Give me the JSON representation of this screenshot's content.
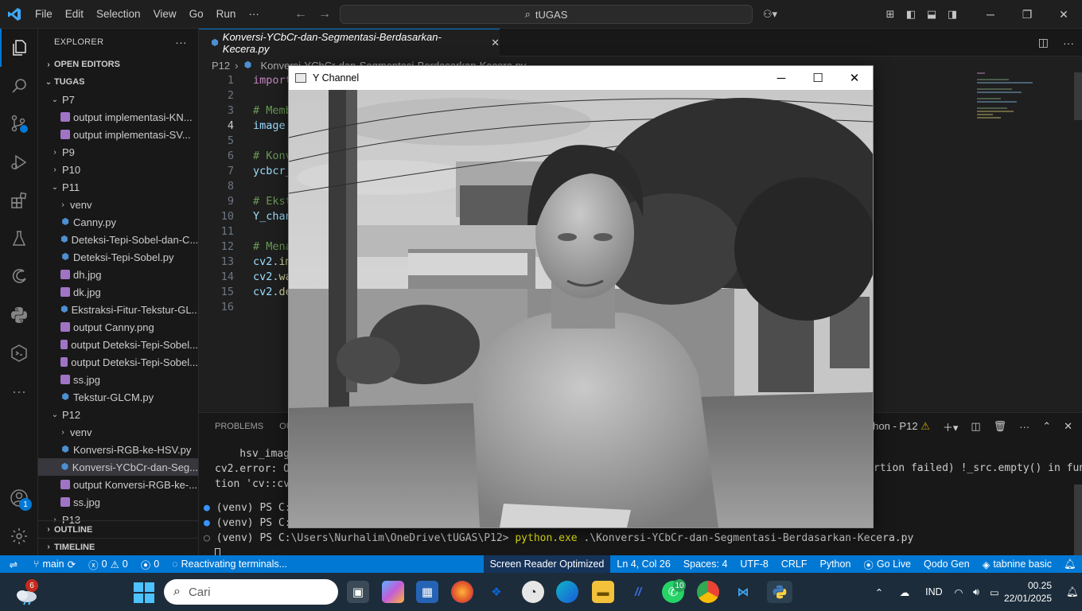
{
  "titlebar": {
    "menus": [
      "File",
      "Edit",
      "Selection",
      "View",
      "Go",
      "Run",
      "···"
    ],
    "search": "tUGAS"
  },
  "activity": {
    "accounts_badge": "1"
  },
  "explorer": {
    "title": "EXPLORER",
    "open_editors": "OPEN EDITORS",
    "root": "TUGAS",
    "tree": [
      {
        "label": "P7",
        "type": "folder-open",
        "indent": 1
      },
      {
        "label": "output implementasi-KN...",
        "type": "img",
        "indent": 2
      },
      {
        "label": "output implementasi-SV...",
        "type": "img",
        "indent": 2
      },
      {
        "label": "P9",
        "type": "folder",
        "indent": 1
      },
      {
        "label": "P10",
        "type": "folder",
        "indent": 1
      },
      {
        "label": "P11",
        "type": "folder-open",
        "indent": 1
      },
      {
        "label": "venv",
        "type": "folder",
        "indent": 2
      },
      {
        "label": "Canny.py",
        "type": "py",
        "indent": 2
      },
      {
        "label": "Deteksi-Tepi-Sobel-dan-C...",
        "type": "py",
        "indent": 2
      },
      {
        "label": "Deteksi-Tepi-Sobel.py",
        "type": "py",
        "indent": 2
      },
      {
        "label": "dh.jpg",
        "type": "img",
        "indent": 2
      },
      {
        "label": "dk.jpg",
        "type": "img",
        "indent": 2
      },
      {
        "label": "Ekstraksi-Fitur-Tekstur-GL...",
        "type": "py",
        "indent": 2
      },
      {
        "label": "output Canny.png",
        "type": "img",
        "indent": 2
      },
      {
        "label": "output Deteksi-Tepi-Sobel...",
        "type": "img",
        "indent": 2
      },
      {
        "label": "output Deteksi-Tepi-Sobel...",
        "type": "img",
        "indent": 2
      },
      {
        "label": "ss.jpg",
        "type": "img",
        "indent": 2
      },
      {
        "label": "Tekstur-GLCM.py",
        "type": "py",
        "indent": 2
      },
      {
        "label": "P12",
        "type": "folder-open",
        "indent": 1
      },
      {
        "label": "venv",
        "type": "folder",
        "indent": 2
      },
      {
        "label": "Konversi-RGB-ke-HSV.py",
        "type": "py",
        "indent": 2
      },
      {
        "label": "Konversi-YCbCr-dan-Seg...",
        "type": "py",
        "indent": 2,
        "selected": true
      },
      {
        "label": "output Konversi-RGB-ke-...",
        "type": "img",
        "indent": 2
      },
      {
        "label": "ss.jpg",
        "type": "img",
        "indent": 2
      },
      {
        "label": "P13",
        "type": "folder",
        "indent": 1
      }
    ],
    "outline": "OUTLINE",
    "timeline": "TIMELINE"
  },
  "editor": {
    "tab_label": "Konversi-YCbCr-dan-Segmentasi-Berdasarkan-Kecera.py",
    "breadcrumb_folder": "P12",
    "breadcrumb_file": "Konversi-YCbCr-dan-Segmentasi-Berdasarkan-Kecera.py",
    "lines": [
      {
        "n": "1",
        "parts": [
          [
            "kw",
            "import"
          ]
        ]
      },
      {
        "n": "2",
        "parts": []
      },
      {
        "n": "3",
        "parts": [
          [
            "cm",
            "# Memb"
          ]
        ]
      },
      {
        "n": "4",
        "parts": [
          [
            "vr",
            "image"
          ]
        ],
        "current": true
      },
      {
        "n": "5",
        "parts": []
      },
      {
        "n": "6",
        "parts": [
          [
            "cm",
            "# Konv"
          ]
        ]
      },
      {
        "n": "7",
        "parts": [
          [
            "vr",
            "ycbcr_"
          ]
        ]
      },
      {
        "n": "8",
        "parts": []
      },
      {
        "n": "9",
        "parts": [
          [
            "cm",
            "# Ekst"
          ]
        ]
      },
      {
        "n": "10",
        "parts": [
          [
            "vr",
            "Y_chan"
          ]
        ]
      },
      {
        "n": "11",
        "parts": []
      },
      {
        "n": "12",
        "parts": [
          [
            "cm",
            "# Mena"
          ]
        ]
      },
      {
        "n": "13",
        "parts": [
          [
            "vr",
            "cv2."
          ],
          [
            "fn",
            "im"
          ]
        ]
      },
      {
        "n": "14",
        "parts": [
          [
            "vr",
            "cv2."
          ],
          [
            "fn",
            "wa"
          ]
        ]
      },
      {
        "n": "15",
        "parts": [
          [
            "vr",
            "cv2."
          ],
          [
            "fn",
            "de"
          ]
        ]
      },
      {
        "n": "16",
        "parts": []
      }
    ]
  },
  "panel": {
    "tabs": [
      "PROBLEMS",
      "OU"
    ],
    "terminal_name": "python - P12",
    "lines_top": [
      "    hsv_image",
      "cv2.error: Op",
      "tion 'cv::cvt"
    ],
    "error_tail": "rtion failed) !_src.empty() in func",
    "prompt_short_1": "(venv) PS C:\\",
    "prompt_short_2": "(venv) PS C:\\",
    "prompt_full": "(venv) PS C:\\Users\\Nurhalim\\OneDrive\\tUGAS\\P12> ",
    "command_exe": "python.exe",
    "command_arg": " .\\Konversi-YCbCr-dan-Segmentasi-Berdasarkan-Kecera.py"
  },
  "statusbar": {
    "branch": "main",
    "errors": "0",
    "warnings": "0",
    "ports": "0",
    "activity": "Reactivating terminals...",
    "screen_reader": "Screen Reader Optimized",
    "position": "Ln 4, Col 26",
    "spaces": "Spaces: 4",
    "encoding": "UTF-8",
    "eol": "CRLF",
    "language": "Python",
    "golive": "Go Live",
    "qodo": "Qodo Gen",
    "tabnine": "tabnine basic"
  },
  "cvwindow": {
    "title": "Y Channel"
  },
  "taskbar": {
    "weather_badge": "6",
    "search_placeholder": "Cari",
    "whatsapp_badge": "10",
    "language": "IND",
    "time": "00.25",
    "date": "22/01/2025"
  }
}
